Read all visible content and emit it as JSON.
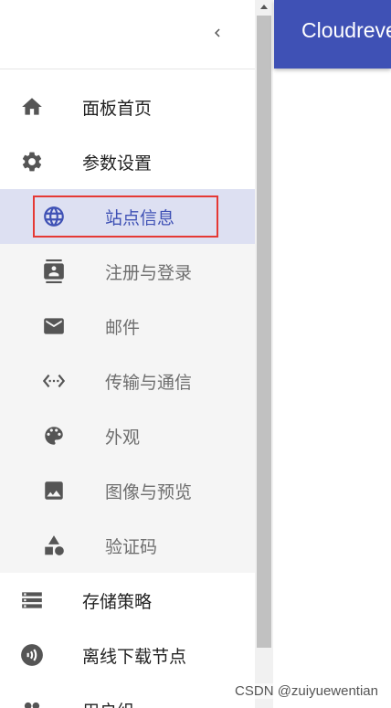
{
  "app": {
    "title": "Cloudreve"
  },
  "drawer": {
    "items": [
      {
        "label": "面板首页",
        "icon": "home-icon"
      },
      {
        "label": "参数设置",
        "icon": "gear-icon"
      },
      {
        "label": "站点信息",
        "icon": "globe-icon",
        "active": true
      },
      {
        "label": "注册与登录",
        "icon": "contact-card-icon"
      },
      {
        "label": "邮件",
        "icon": "mail-icon"
      },
      {
        "label": "传输与通信",
        "icon": "code-arrows-icon"
      },
      {
        "label": "外观",
        "icon": "palette-icon"
      },
      {
        "label": "图像与预览",
        "icon": "image-icon"
      },
      {
        "label": "验证码",
        "icon": "shapes-icon"
      },
      {
        "label": "存储策略",
        "icon": "storage-icon"
      },
      {
        "label": "离线下载节点",
        "icon": "download-node-icon"
      },
      {
        "label": "用户组",
        "icon": "group-icon"
      }
    ]
  },
  "colors": {
    "primary": "#3f51b5",
    "active_bg": "#dde0f2",
    "highlight": "#e53935"
  },
  "watermark": "CSDN @zuiyuewentian"
}
